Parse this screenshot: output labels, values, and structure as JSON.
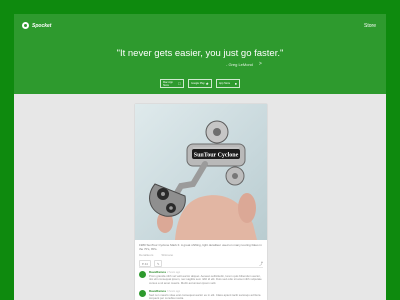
{
  "header": {
    "logo": "Spocket",
    "store_link": "Store"
  },
  "hero": {
    "quote": "\"It never gets easier, you just go faster.\"",
    "attribution": "- Greg LeMond",
    "next_symbol": ">",
    "badges": [
      {
        "label": "Mac App Store",
        "icon": "apple-icon",
        "glyph": ""
      },
      {
        "label": "Google Play",
        "icon": "android-icon",
        "glyph": "★"
      },
      {
        "label": "App Store",
        "icon": "apple-icon",
        "glyph": "●"
      }
    ]
  },
  "post": {
    "derailleur_label": "SunTour Cyclone",
    "caption": "1980 SunTour Cyclone Mark II. A great shifting, light derailleur used on many touring bikes in the 70's, 80's.",
    "meta": [
      "Derailleurs",
      "Shimano"
    ],
    "like_count": "44",
    "share_icon": "share-icon",
    "comments": [
      {
        "name": "DaveRamos",
        "time": "2 hours ago",
        "text": "Proin gravida nibh vel velit auctor aliquet. Aenean sollicitudin, lorem quis bibendum auctor, nisi elit consequat ipsum, nec sagittis sem nibh id elit. Duis sed odio sit amet nibh vulputate cursus a sit amet mauris. Morbi accumsan ipsum velit."
      },
      {
        "name": "DaveRamos",
        "time": "3 hours ago",
        "text": "Sed non mauris vitae erat consequat auctor eu in elit. Class aptent taciti sociosqu ad litora torquent per conubia nostra."
      }
    ]
  },
  "colors": {
    "background": "#0e8a0e",
    "hero": "#2e9a2e",
    "page": "#e7e7e7"
  }
}
